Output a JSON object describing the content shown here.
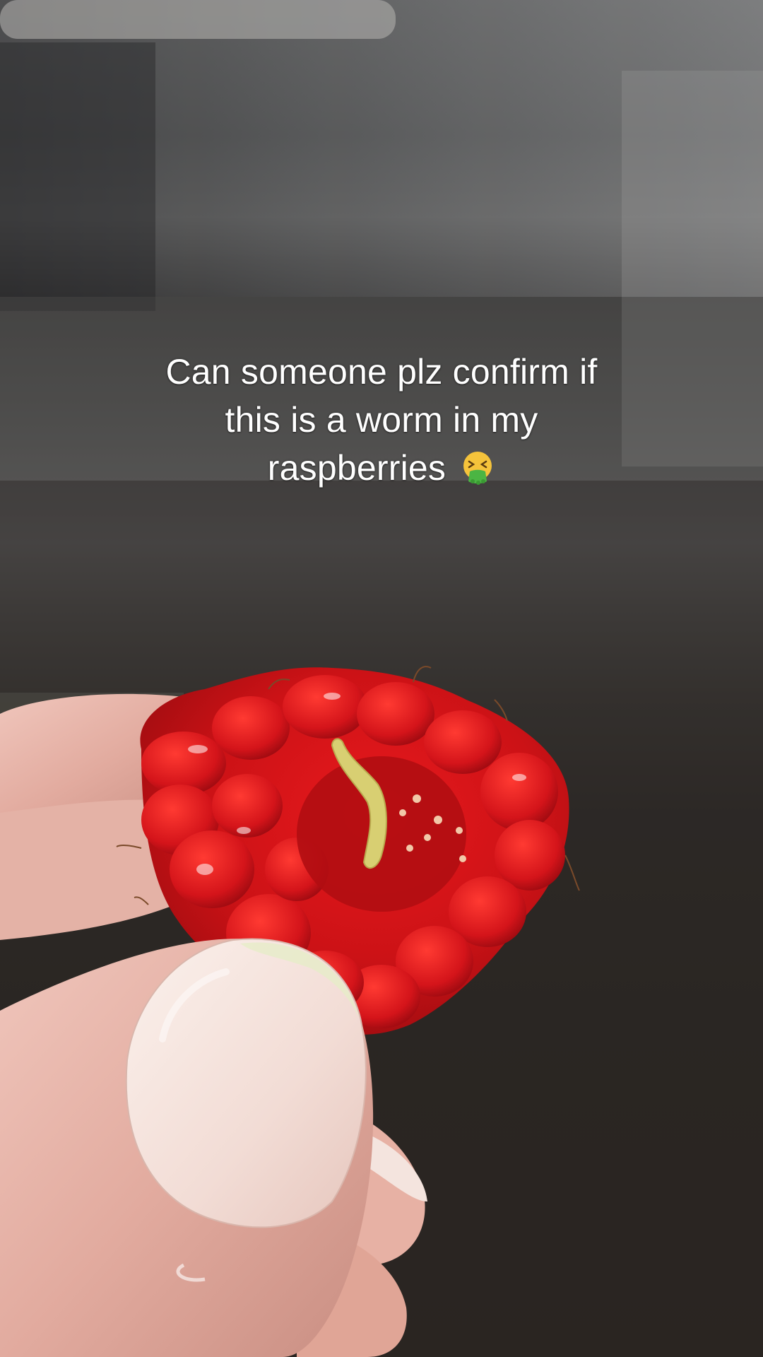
{
  "caption": {
    "line1": "Can someone plz confirm if",
    "line2": "this is a worm in my",
    "line3": "raspberries",
    "emoji": "vomiting-face-emoji"
  },
  "colors": {
    "raspberry": "#d41418",
    "worm": "#d8cf72",
    "nail": "#f3e2dc",
    "skin": "#e8b7ad",
    "text": "#ffffff"
  }
}
